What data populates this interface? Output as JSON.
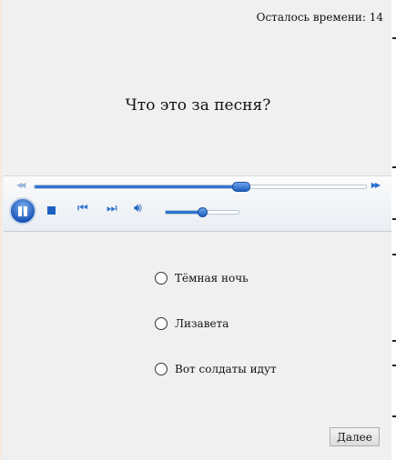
{
  "timer": {
    "text": "Осталось времени: 14"
  },
  "question": {
    "text": "Что это за песня?"
  },
  "player": {
    "state": "playing",
    "seek_progress": 0.62,
    "volume": 0.5,
    "seek_back_icon": "rewind-icon",
    "seek_forward_icon": "fast-forward-icon",
    "icons": {
      "play_pause": "pause-icon",
      "stop": "stop-icon",
      "prev": "previous-icon",
      "next": "next-icon",
      "volume": "volume-icon"
    },
    "accent_color": "#2f74d0"
  },
  "answers": [
    {
      "label": "Тёмная ночь",
      "selected": false
    },
    {
      "label": "Лизавета",
      "selected": false
    },
    {
      "label": "Вот солдаты идут",
      "selected": false
    }
  ],
  "next_button": {
    "label": "Далее"
  }
}
